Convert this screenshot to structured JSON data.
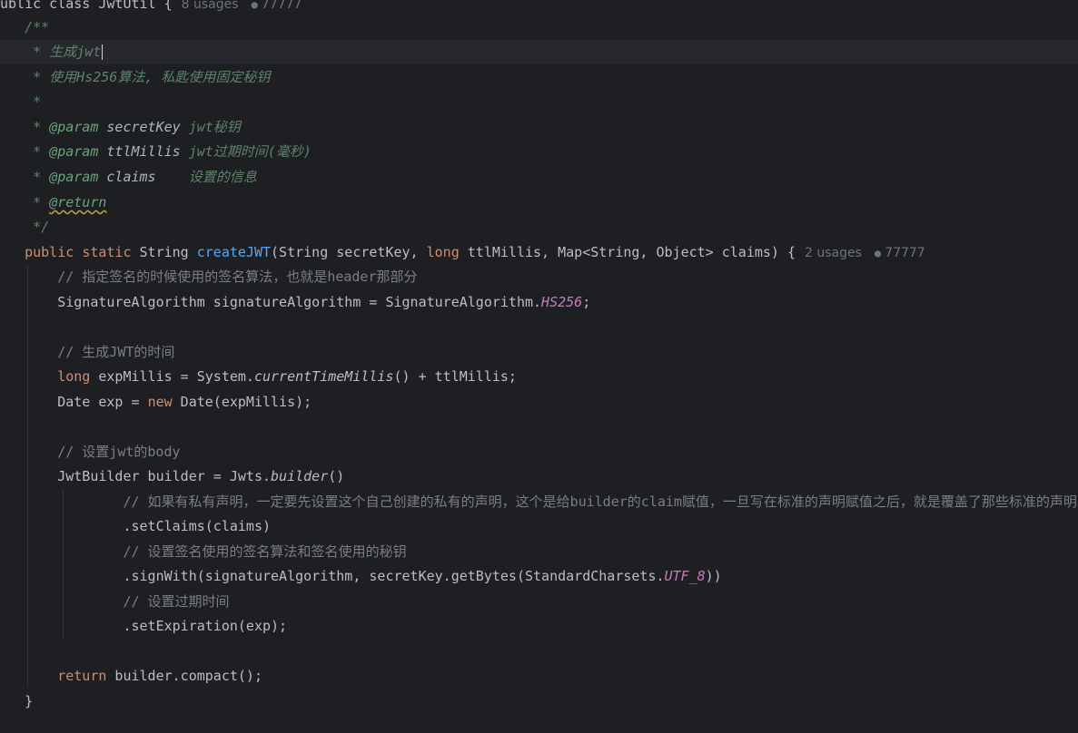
{
  "class_header": {
    "prefix": "ublic class JwtUtil {",
    "usages": "8 usages",
    "author": "77777"
  },
  "javadoc": {
    "open": "/**",
    "line1_star": " * ",
    "line1_text": "生成jwt",
    "line2": " * 使用Hs256算法, 私匙使用固定秘钥",
    "line3": " *",
    "param_tag": "@param",
    "params": [
      {
        "name": "secretKey",
        "desc": "jwt秘钥",
        "pad": " "
      },
      {
        "name": "ttlMillis",
        "desc": "jwt过期时间(毫秒)",
        "pad": " "
      },
      {
        "name": "claims",
        "desc": "设置的信息",
        "pad": "    "
      }
    ],
    "return_tag": "@return",
    "close": " */"
  },
  "method": {
    "public": "public",
    "static": "static",
    "ret": "String",
    "name": "createJWT",
    "p1": "(String secretKey, ",
    "long": "long",
    "p2": " ttlMillis, Map<String, Object> claims) {",
    "usages": "2 usages",
    "author": "77777"
  },
  "body": {
    "c1": "// 指定签名的时候使用的签名算法，也就是header那部分",
    "l1a": "SignatureAlgorithm signatureAlgorithm = SignatureAlgorithm.",
    "l1b": "HS256",
    "l1c": ";",
    "c2": "// 生成JWT的时间",
    "l2a": "long",
    "l2b": " expMillis = System.",
    "l2c": "currentTimeMillis",
    "l2d": "() + ttlMillis;",
    "l3a": "Date exp = ",
    "l3b": "new",
    "l3c": " Date(expMillis);",
    "c3": "// 设置jwt的body",
    "l4a": "JwtBuilder builder = Jwts.",
    "l4b": "builder",
    "l4c": "()",
    "c4": "// 如果有私有声明，一定要先设置这个自己创建的私有的声明，这个是给builder的claim赋值，一旦写在标准的声明赋值之后，就是覆盖了那些标准的声明的",
    "l5": ".setClaims(claims)",
    "c5": "// 设置签名使用的签名算法和签名使用的秘钥",
    "l6a": ".signWith(signatureAlgorithm, secretKey.getBytes(StandardCharsets.",
    "l6b": "UTF_8",
    "l6c": "))",
    "c6": "// 设置过期时间",
    "l7": ".setExpiration(exp);",
    "l8a": "return",
    "l8b": " builder.compact();",
    "close": "}"
  },
  "colors": {
    "background": "#1e1f22",
    "keyword": "#cf8e6d",
    "function": "#56a8f5",
    "doc_comment": "#5f826b",
    "constant": "#c77dbb",
    "line_comment": "#7a7e85"
  },
  "icons": {
    "bulb": "lightbulb-icon",
    "user": "user-icon"
  }
}
